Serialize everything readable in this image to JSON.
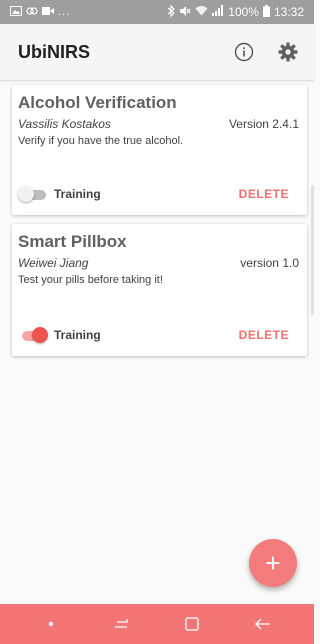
{
  "status_bar": {
    "left_overflow": "...",
    "battery_percent": "100%",
    "time": "13:32",
    "icons": [
      "gallery-icon",
      "link-icon",
      "video-icon",
      "bluetooth-icon",
      "mute-icon",
      "wifi-icon",
      "signal-icon",
      "battery-icon"
    ]
  },
  "app_bar": {
    "title": "UbiNIRS",
    "actions": [
      "info-icon",
      "settings-gear-icon"
    ]
  },
  "cards": [
    {
      "title": "Alcohol Verification",
      "author": "Vassilis Kostakos",
      "version": "Version 2.4.1",
      "description": "Verify if you have the true alcohol.",
      "training_label": "Training",
      "training_on": false,
      "delete_label": "DELETE"
    },
    {
      "title": "Smart Pillbox",
      "author": "Weiwei Jiang",
      "version": "version 1.0",
      "description": "Test your pills before taking it!",
      "training_label": "Training",
      "training_on": true,
      "delete_label": "DELETE"
    }
  ],
  "fab": {
    "label": "+"
  },
  "nav_bar": {
    "buttons": [
      "dot-icon",
      "recent-apps-icon",
      "home-icon",
      "back-icon"
    ]
  },
  "colors": {
    "accent": "#f37575",
    "status_bar": "#9e9e9e",
    "delete": "#ef6f6f"
  }
}
